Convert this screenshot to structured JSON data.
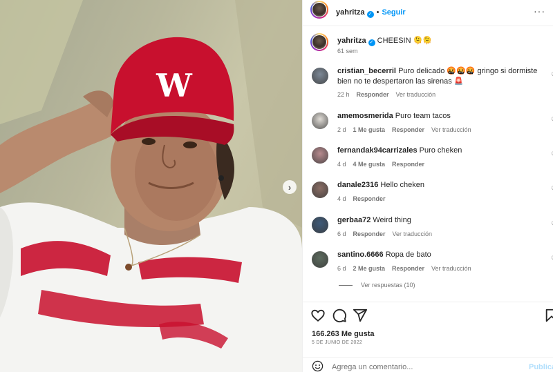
{
  "post": {
    "author": "yahritza",
    "follow_label": "Seguir",
    "caption": "CHEESIN 🫠🫠",
    "caption_time": "61 sem",
    "next_icon": "chevron-right-icon",
    "likes": "166.263 Me gusta",
    "date": "5 DE JUNIO DE 2022",
    "add_comment_placeholder": "Agrega un comentario...",
    "publish_label": "Publicar",
    "view_replies": "Ver respuestas (10)"
  },
  "comments": [
    {
      "user": "cristian_becerril",
      "text": "Puro delicado 🤬🤬🤬 gringo si dormiste bien no te despertaron las sirenas 🚨",
      "time": "22 h",
      "likes": "",
      "reply": "Responder",
      "translate": "Ver traducción",
      "avatar_color": "#7c8896"
    },
    {
      "user": "amemosmerida",
      "text": "Puro team tacos",
      "time": "2 d",
      "likes": "1 Me gusta",
      "reply": "Responder",
      "translate": "Ver traducción",
      "avatar_color": "#e0dcd6"
    },
    {
      "user": "fernandak94carrizales",
      "text": "Puro cheken",
      "time": "4 d",
      "likes": "4 Me gusta",
      "reply": "Responder",
      "translate": "",
      "avatar_color": "#b78a8e"
    },
    {
      "user": "danale2316",
      "text": "Hello cheken",
      "time": "4 d",
      "likes": "",
      "reply": "Responder",
      "translate": "",
      "avatar_color": "#8a6d64"
    },
    {
      "user": "gerbaa72",
      "text": "Weird thing",
      "time": "6 d",
      "likes": "",
      "reply": "Responder",
      "translate": "Ver traducción",
      "avatar_color": "#3e5a78"
    },
    {
      "user": "santino.6666",
      "text": "Ropa de bato",
      "time": "6 d",
      "likes": "2 Me gusta",
      "reply": "Responder",
      "translate": "Ver traducción",
      "avatar_color": "#5c6b5e"
    }
  ],
  "colors": {
    "accent": "#0095f6",
    "muted": "#737373",
    "text": "#262626",
    "cap_red": "#c8102e"
  }
}
